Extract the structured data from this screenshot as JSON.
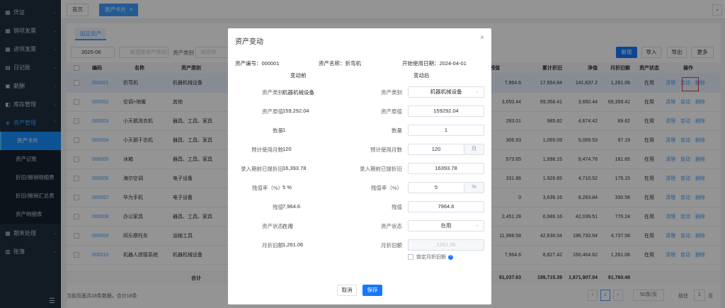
{
  "sidebar": {
    "items": [
      {
        "label": "凭证",
        "icon": "grid-icon"
      },
      {
        "label": "销项发票",
        "icon": "grid-icon"
      },
      {
        "label": "进项发票",
        "icon": "grid-icon"
      },
      {
        "label": "日记账",
        "icon": "calendar-icon"
      },
      {
        "label": "薪酬",
        "icon": "wallet-icon"
      },
      {
        "label": "库存管理",
        "icon": "box-icon"
      },
      {
        "label": "资产管理",
        "icon": "asset-icon"
      }
    ],
    "sub_items": [
      {
        "label": "资产卡片"
      },
      {
        "label": "资产记账"
      },
      {
        "label": "折旧/摊销明细表"
      },
      {
        "label": "折旧/摊销汇总表"
      },
      {
        "label": "资产明细表"
      }
    ],
    "bottom_items": [
      {
        "label": "期末处理",
        "icon": "grid-icon"
      },
      {
        "label": "账簿",
        "icon": "book-icon"
      }
    ]
  },
  "tabs": {
    "home": "首页",
    "current": "资产卡片",
    "close": "×",
    "more": "⌄"
  },
  "content": {
    "subtab": "固定资产",
    "filters": {
      "period": "2025-06",
      "category_placeholder": "请选择资产类别",
      "type_label": "资产类别",
      "type_placeholder": "请选择"
    },
    "buttons": {
      "add": "新增",
      "import": "导入",
      "export": "导出",
      "more": "更多"
    }
  },
  "table": {
    "headers": {
      "code": "编码",
      "name": "名称",
      "type": "资产类别",
      "orig": "残值",
      "accum": "累计折旧",
      "net": "净值",
      "monthly": "月折旧额",
      "status": "资产状态",
      "ops": "操作"
    },
    "rows": [
      {
        "code": "000001",
        "name": "折弯机",
        "type": "机器机械设备",
        "orig": "7,964.6",
        "accum": "17,654.84",
        "net": "141,637.2",
        "monthly": "1,261.06",
        "status": "在用"
      },
      {
        "code": "000002",
        "name": "空调+地暖",
        "type": "其他",
        "orig": "3,650.44",
        "accum": "69,358.41",
        "net": "3,650.44",
        "monthly": "69,358.41",
        "status": "在用"
      },
      {
        "code": "000003",
        "name": "小天鹅洗衣机",
        "type": "器具、工具、家具",
        "orig": "283.01",
        "accum": "985.82",
        "net": "4,674.42",
        "monthly": "89.62",
        "status": "在用"
      },
      {
        "code": "000004",
        "name": "小天鹅干衣机",
        "type": "器具、工具、家具",
        "orig": "306.93",
        "accum": "1,069.09",
        "net": "5,069.53",
        "monthly": "97.19",
        "status": "在用"
      },
      {
        "code": "000005",
        "name": "冰箱",
        "type": "器具、工具、家具",
        "orig": "573.65",
        "accum": "1,998.15",
        "net": "9,474.76",
        "monthly": "181.65",
        "status": "在用"
      },
      {
        "code": "000006",
        "name": "海尔空调",
        "type": "电子设备",
        "orig": "331.86",
        "accum": "1,926.65",
        "net": "4,710.52",
        "monthly": "175.15",
        "status": "在用"
      },
      {
        "code": "000007",
        "name": "华为手机",
        "type": "电子设备",
        "orig": "0",
        "accum": "3,636.16",
        "net": "8,263.84",
        "monthly": "330.56",
        "status": "在用"
      },
      {
        "code": "000008",
        "name": "办公家具",
        "type": "器具、工具、家具",
        "orig": "2,451.28",
        "accum": "6,986.16",
        "net": "42,039.51",
        "monthly": "776.24",
        "status": "在用"
      },
      {
        "code": "000009",
        "name": "同乐摩托车",
        "type": "运输工具",
        "orig": "11,968.58",
        "accum": "42,638.04",
        "net": "196,733.64",
        "monthly": "4,737.56",
        "status": "在用"
      },
      {
        "code": "000010",
        "name": "机器人焊接系统",
        "type": "机器机械设备",
        "orig": "7,964.6",
        "accum": "8,827.42",
        "net": "150,464.62",
        "monthly": "1,261.06",
        "status": "在用"
      }
    ],
    "actions": {
      "clear": "清理",
      "change": "变动",
      "delete": "删除"
    },
    "sum": {
      "label": "合计",
      "orig": "91,037.63",
      "accum": "199,715.39",
      "net": "1,671,907.04",
      "monthly": "91,760.49"
    }
  },
  "footer": {
    "summary": "当前页面共18条数据，合计18条",
    "page": "1",
    "page_size": "50条/页",
    "goto_label": "前往",
    "goto_value": "1",
    "goto_unit": "页",
    "prev": "‹",
    "next": "›"
  },
  "modal": {
    "title": "资产变动",
    "close": "×",
    "info": {
      "code": "资产编号：000001",
      "name": "资产名称：折弯机",
      "date": "开始使用日期：2024-04-01"
    },
    "before_title": "变动前",
    "after_title": "变动后",
    "fields": [
      {
        "label": "资产类别",
        "before": "机器机械设备",
        "after": "机器机械设备"
      },
      {
        "label": "资产原值",
        "before": "159,292.04",
        "after": "159292.04"
      },
      {
        "label": "数量",
        "before": "1",
        "after": "1"
      },
      {
        "label": "预计使用月数",
        "before": "120",
        "after": "120",
        "suffix": "月"
      },
      {
        "label": "录入期前已提折旧",
        "before": "16,393.78",
        "after": "16393.78"
      },
      {
        "label": "残值率（%）",
        "before": "5 %",
        "after": "5",
        "suffix": "%"
      },
      {
        "label": "残值",
        "before": "7,964.6",
        "after": "7964.6"
      },
      {
        "label": "资产状态",
        "before": "在用",
        "after": "在用"
      },
      {
        "label": "月折旧额",
        "before": "1,261.06",
        "after": "1261.06"
      }
    ],
    "lock_label": "锁定月折旧额",
    "cancel": "取消",
    "save": "保存"
  }
}
